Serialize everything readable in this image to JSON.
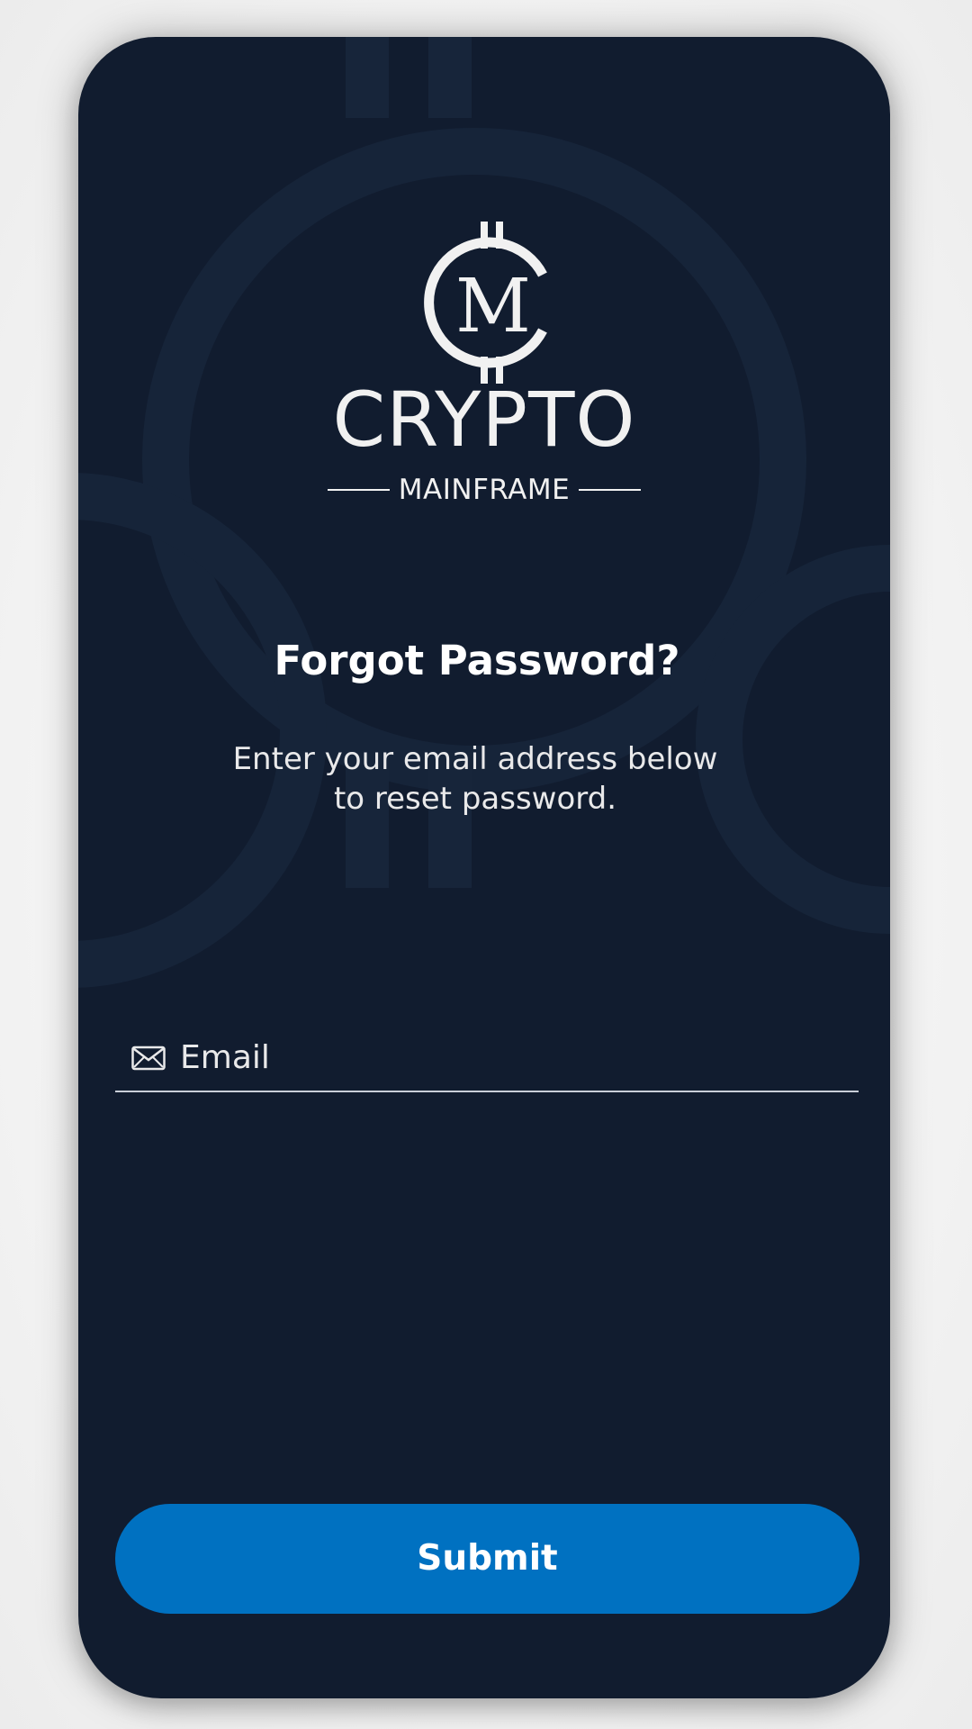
{
  "brand": {
    "title": "CRYPTO",
    "subtitle": "MAINFRAME",
    "logo_icon": "crypto-mainframe-logo-icon"
  },
  "screen": {
    "heading": "Forgot Password?",
    "description_line1": "Enter your email address below",
    "description_line2": "to reset password."
  },
  "form": {
    "email": {
      "icon": "envelope-icon",
      "placeholder": "Email",
      "value": ""
    },
    "submit_label": "Submit"
  },
  "colors": {
    "background": "#111c2f",
    "accent": "#0071c1",
    "text": "#f1f1f1"
  }
}
